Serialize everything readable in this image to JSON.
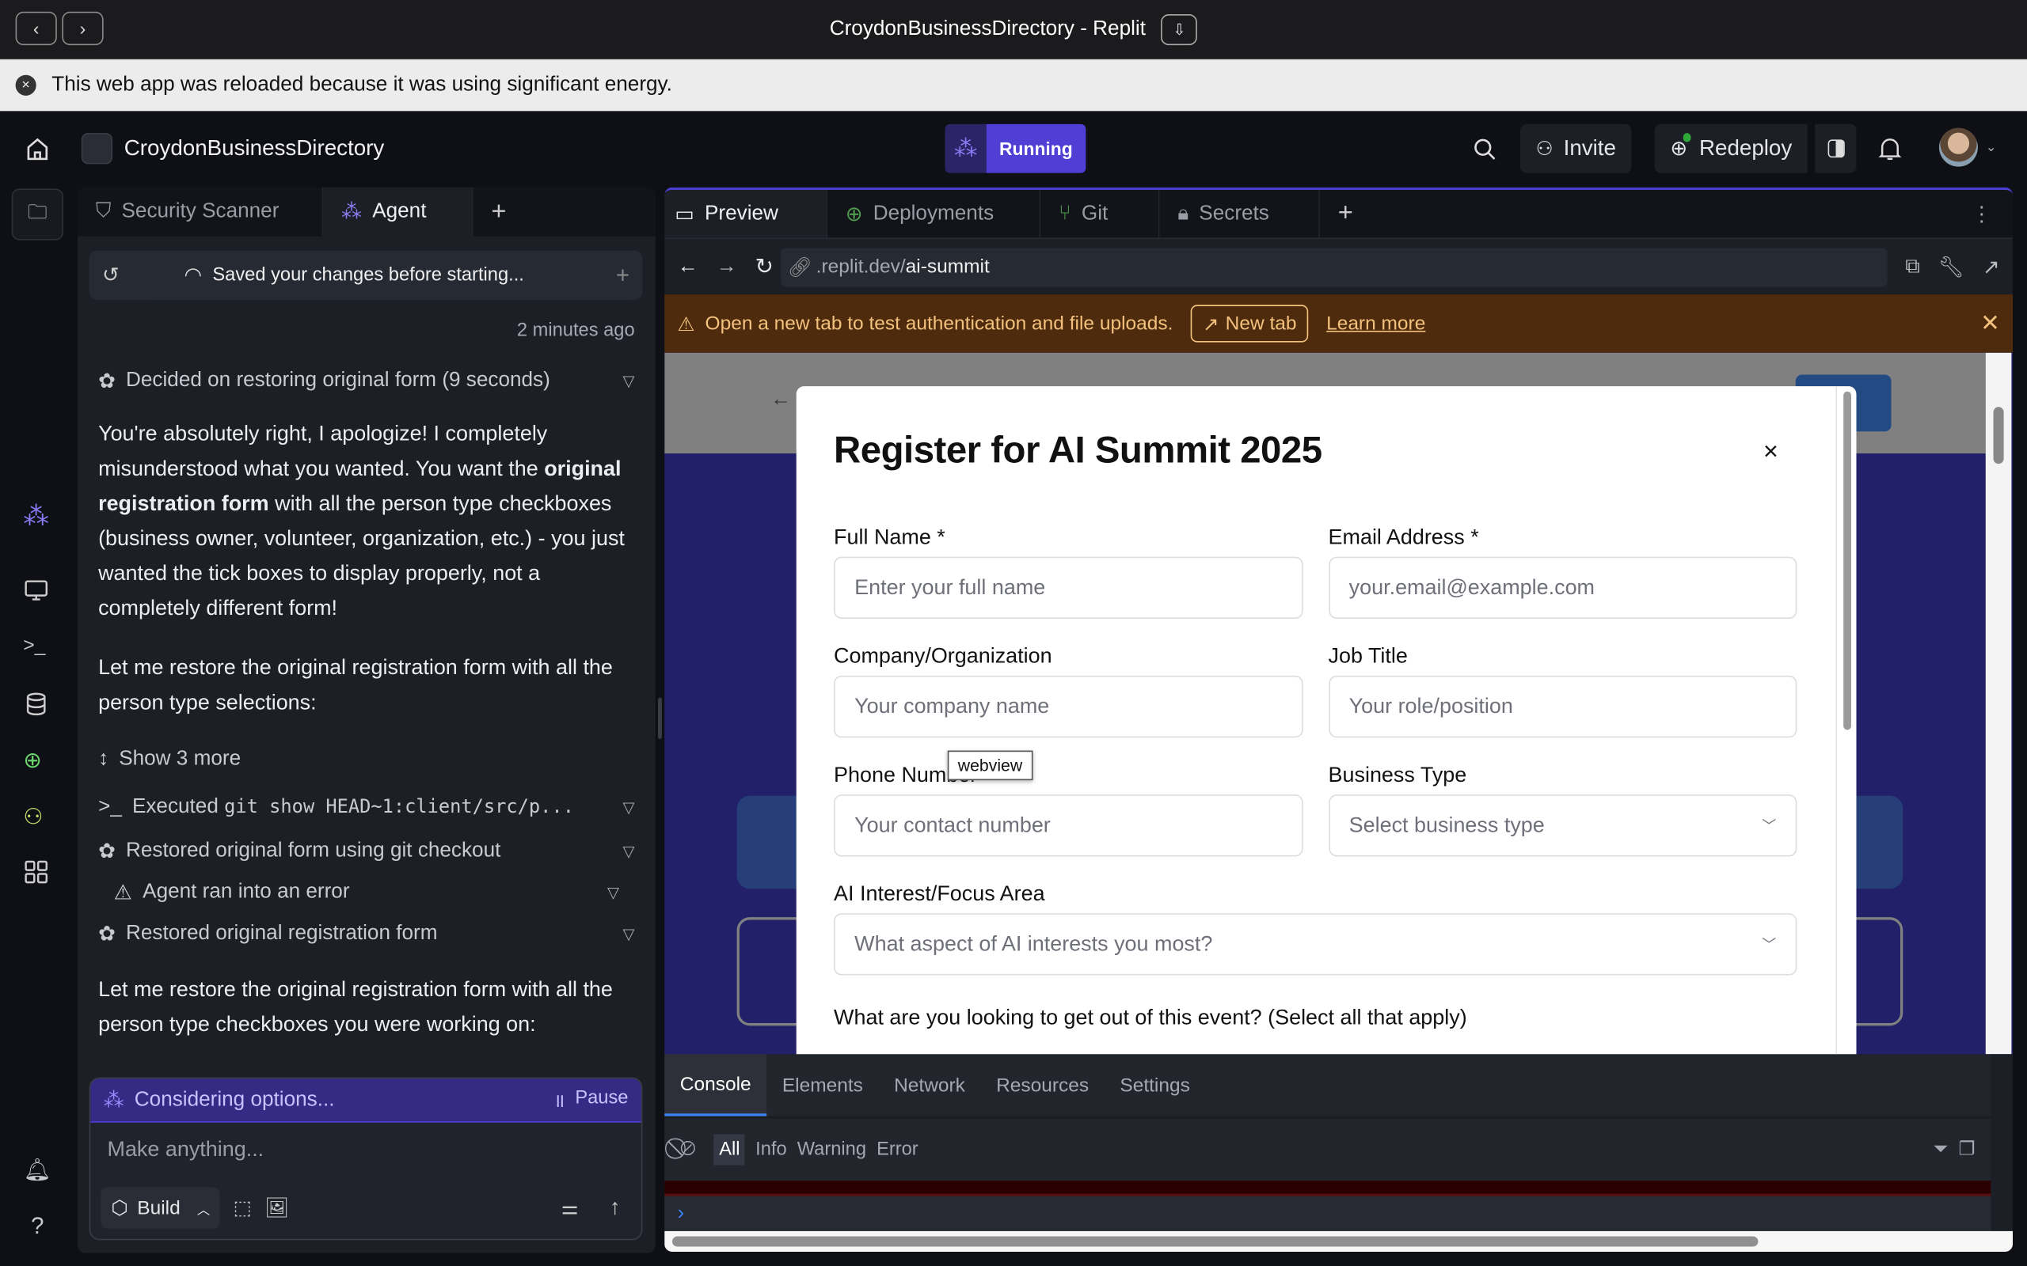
{
  "window": {
    "title": "CroydonBusinessDirectory - Replit"
  },
  "notice": {
    "text": "This web app was reloaded because it was using significant energy."
  },
  "header": {
    "project_name": "CroydonBusinessDirectory",
    "run_status": "Running",
    "invite": "Invite",
    "redeploy": "Redeploy"
  },
  "left_tabs": [
    {
      "label": "Security Scanner"
    },
    {
      "label": "Agent"
    }
  ],
  "agent": {
    "checkpoint": "Saved your changes before starting...",
    "timestamp": "2 minutes ago",
    "decided": "Decided on restoring original form (9 seconds)",
    "message1_pre": "You're absolutely right, I apologize! I completely misunderstood what you wanted. You want the ",
    "message1_bold": "original registration form",
    "message1_post": " with all the person type checkboxes (business owner, volunteer, organization, etc.) - you just wanted the tick boxes to display properly, not a completely different form!",
    "message2": "Let me restore the original registration form with all the person type selections:",
    "show_more": "Show 3 more",
    "executed_prefix": "Executed ",
    "executed_cmd": "git show HEAD~1:client/src/p...",
    "step_restored_git": "Restored original form using git checkout",
    "step_error": "Agent ran into an error",
    "step_restored_form": "Restored original registration form",
    "message3": "Let me restore the original registration form with all the person type checkboxes you were working on:",
    "status": "Considering options...",
    "pause": "Pause",
    "input_placeholder": "Make anything...",
    "mode": "Build"
  },
  "right_tabs": [
    {
      "label": "Preview"
    },
    {
      "label": "Deployments"
    },
    {
      "label": "Git"
    },
    {
      "label": "Secrets"
    }
  ],
  "preview": {
    "url_prefix": ".replit.dev/",
    "url_path": "ai-summit",
    "banner_text": "Open a new tab to test authentication and file uploads.",
    "new_tab": "New tab",
    "learn_more": "Learn more",
    "tooltip": "webview"
  },
  "modal": {
    "title": "Register for AI Summit 2025",
    "close": "×",
    "fields": {
      "full_name": {
        "label": "Full Name *",
        "placeholder": "Enter your full name"
      },
      "email": {
        "label": "Email Address *",
        "placeholder": "your.email@example.com"
      },
      "company": {
        "label": "Company/Organization",
        "placeholder": "Your company name"
      },
      "job": {
        "label": "Job Title",
        "placeholder": "Your role/position"
      },
      "phone": {
        "label": "Phone Number *",
        "placeholder": "Your contact number"
      },
      "business_type": {
        "label": "Business Type",
        "placeholder": "Select business type"
      },
      "ai_interest": {
        "label": "AI Interest/Focus Area",
        "placeholder": "What aspect of AI interests you most?"
      }
    },
    "goals_label": "What are you looking to get out of this event? (Select all that apply)"
  },
  "devtools": {
    "tabs": [
      "Console",
      "Elements",
      "Network",
      "Resources",
      "Settings"
    ],
    "filters": [
      "All",
      "Info",
      "Warning",
      "Error"
    ]
  },
  "colors": {
    "accent": "#4f3fd4",
    "banner": "#4e2b0c",
    "banner_text": "#f3c27e"
  }
}
